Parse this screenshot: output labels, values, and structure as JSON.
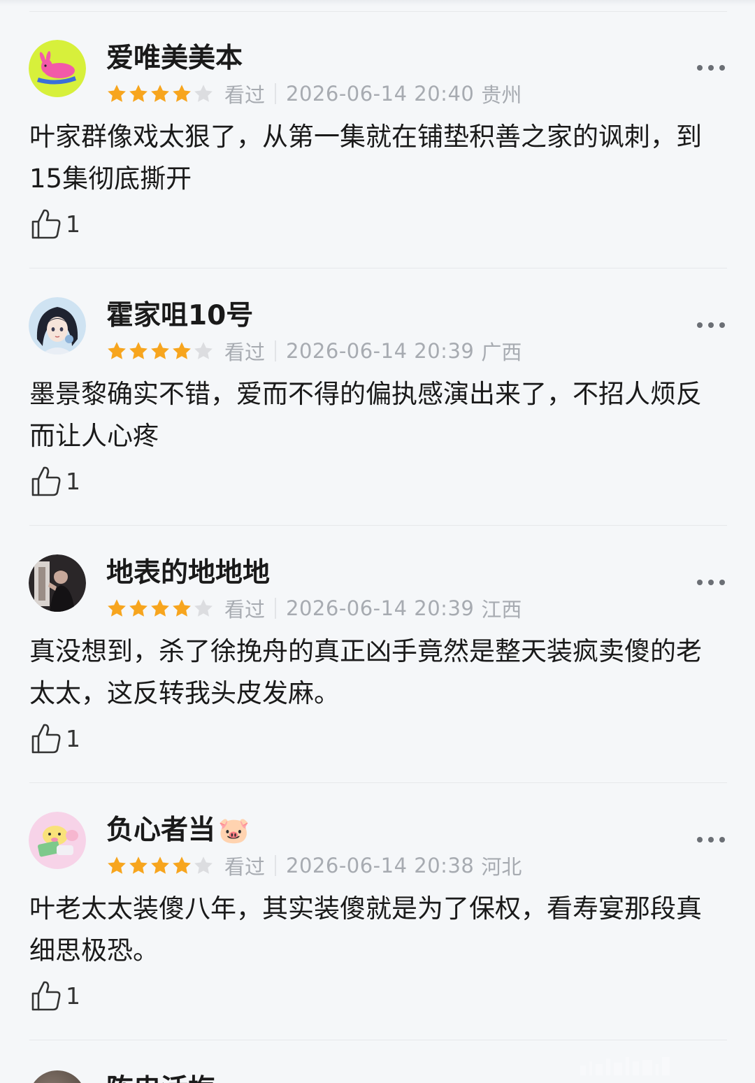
{
  "reviews": [
    {
      "username": "爱唯美美本",
      "avatar": "pink-bunny-avatar",
      "rating": 4,
      "seen_label": "看过",
      "time": "2026-06-14 20:40",
      "location": "贵州",
      "content": "叶家群像戏太狠了，从第一集就在铺垫积善之家的讽刺，到15集彻底撕开",
      "likes": "1"
    },
    {
      "username": "霍家咀10号",
      "avatar": "anime-girl-avatar",
      "rating": 4,
      "seen_label": "看过",
      "time": "2026-06-14 20:39",
      "location": "广西",
      "content": "墨景黎确实不错，爱而不得的偏执感演出来了，不招人烦反而让人心疼",
      "likes": "1"
    },
    {
      "username": "地表的地地地",
      "avatar": "man-in-doorway-avatar",
      "rating": 4,
      "seen_label": "看过",
      "time": "2026-06-14 20:39",
      "location": "江西",
      "content": "真没想到，杀了徐挽舟的真正凶手竟然是整天装疯卖傻的老太太，这反转我头皮发麻。",
      "likes": "1"
    },
    {
      "username": "负心者当",
      "emoji": "🐷",
      "avatar": "cartoon-pig-avatar",
      "rating": 4,
      "seen_label": "看过",
      "time": "2026-06-14 20:38",
      "location": "河北",
      "content": "叶老太太装傻八年，其实装傻就是为了保权，看寿宴那段真细思极恐。",
      "likes": "1"
    }
  ],
  "peek": {
    "username": "陈忠活梅"
  },
  "colors": {
    "star_filled": "#f7a51e",
    "star_empty": "#dcdde0",
    "meta_text": "#a7abb1",
    "background": "#f5f7f9"
  }
}
